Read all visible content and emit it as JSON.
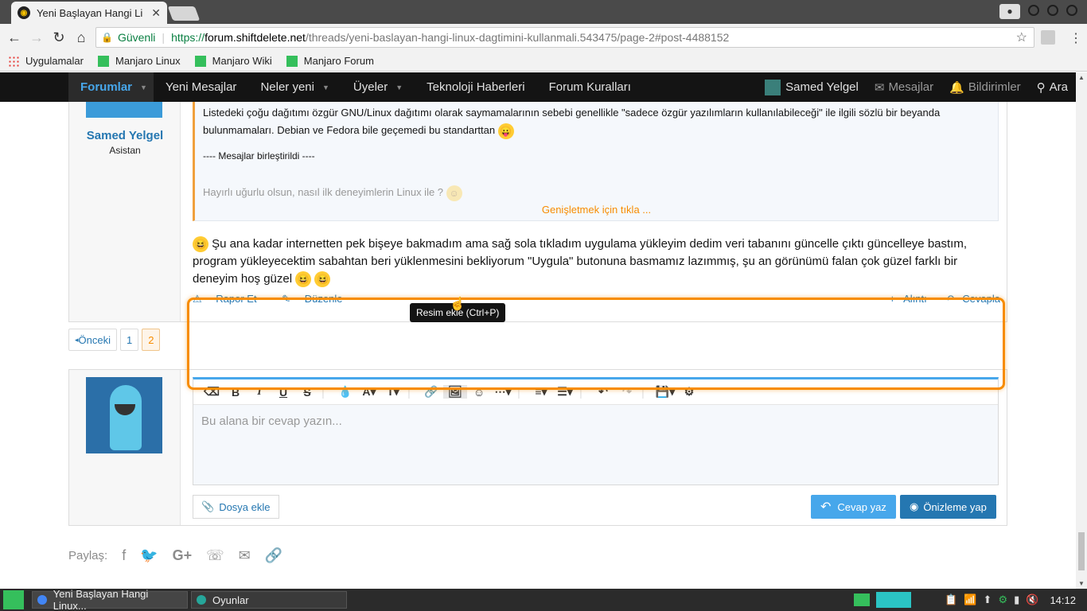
{
  "browser": {
    "tab_title": "Yeni Başlayan Hangi Li",
    "secure_label": "Güvenli",
    "url_proto": "https://",
    "url_host": "forum.shiftdelete.net",
    "url_path": "/threads/yeni-baslayan-hangi-linux-dagtimini-kullanmali.543475/page-2#post-4488152"
  },
  "bookmarks": [
    {
      "label": "Uygulamalar"
    },
    {
      "label": "Manjaro Linux"
    },
    {
      "label": "Manjaro Wiki"
    },
    {
      "label": "Manjaro Forum"
    }
  ],
  "nav": {
    "forumlar": "Forumlar",
    "yeni_mesajlar": "Yeni Mesajlar",
    "neler_yeni": "Neler yeni",
    "uyeler": "Üyeler",
    "teknoloji": "Teknoloji Haberleri",
    "kurallar": "Forum Kuralları",
    "user": "Samed Yelgel",
    "mesajlar": "Mesajlar",
    "bildirimler": "Bildirimler",
    "ara": "Ara"
  },
  "post": {
    "author": "Samed Yelgel",
    "role": "Asistan",
    "quote_line1": "Listedeki çoğu dağıtımı özgür GNU/Linux dağıtımı olarak saymamalarının sebebi genellikle \"sadece özgür yazılımların kullanılabileceği\" ile ilgili sözlü bir beyanda",
    "quote_line2": "bulunmamaları. Debian ve Fedora bile geçemedi bu standarttan",
    "quote_merged": "---- Mesajlar birleştirildi ----",
    "quote_faded": "Hayırlı uğurlu olsun, nasıl ilk deneyimlerin Linux ile ?",
    "expand": "Genişletmek için tıkla ...",
    "body_line1": "Şu ana kadar internetten pek bişeye bakmadım ama sağ sola tıkladım uygulama yükleyim dedim veri tabanını güncelle çıktı güncelleye bastım,",
    "body_line2": "program yükleyecektim sabahtan beri yüklenmesini bekliyorum \"Uygula\" butonuna basmamız lazımmış, şu an görünümü falan çok güzel farklı bir",
    "body_line3": "deneyim hoş güzel",
    "report": "Rapor Et",
    "edit": "Düzenle",
    "quote_btn": "Alıntı",
    "reply_btn": "Cevapla"
  },
  "pager": {
    "prev": "Önceki",
    "p1": "1",
    "p2": "2"
  },
  "reply": {
    "placeholder": "Bu alana bir cevap yazın...",
    "tooltip": "Resim ekle (Ctrl+P)",
    "attach": "Dosya ekle",
    "submit": "Cevap yaz",
    "preview": "Önizleme yap"
  },
  "share": {
    "label": "Paylaş:"
  },
  "taskbar": {
    "task1": "Yeni Başlayan Hangi Linux...",
    "task2": "Oyunlar",
    "clock": "14:12"
  },
  "colors": {
    "accent": "#47a7eb",
    "orange": "#f78c00",
    "nav_bg": "#141414"
  }
}
